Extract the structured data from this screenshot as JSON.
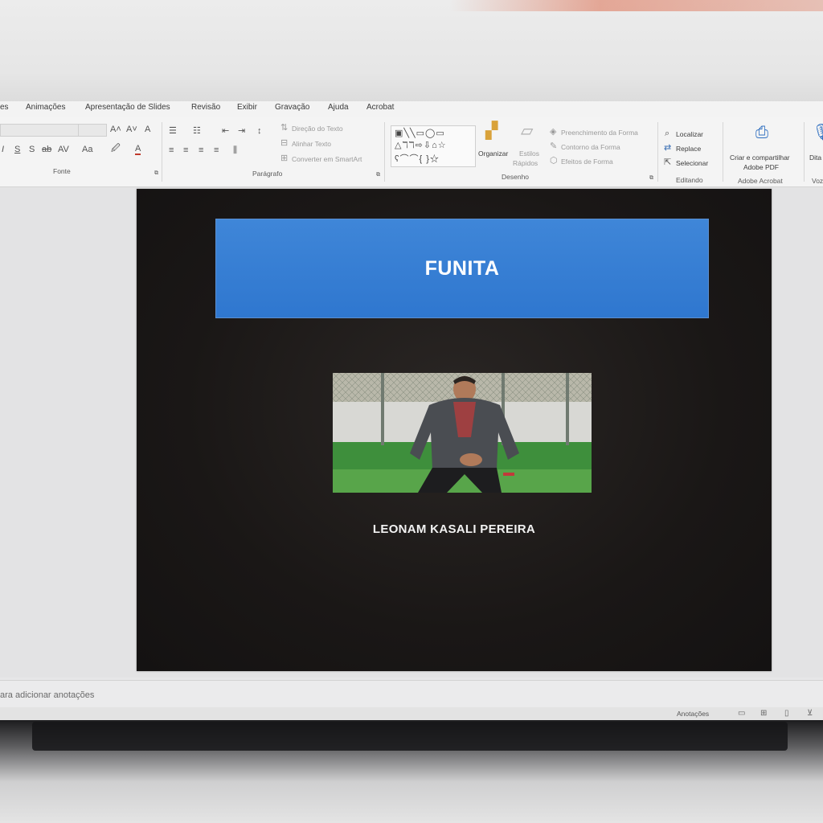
{
  "tabs": [
    "es",
    "Animações",
    "Apresentação de Slides",
    "Revisão",
    "Exibir",
    "Gravação",
    "Ajuda",
    "Acrobat"
  ],
  "ribbon": {
    "fonte": {
      "label": "Fonte",
      "grow": "A˄",
      "shrink": "A˅",
      "clear": "A",
      "italic": "I",
      "underline": "S",
      "shadow": "S",
      "strike": "ab",
      "spacing": "AV",
      "case": "Aa"
    },
    "paragrafo": {
      "label": "Parágrafo",
      "text_direction": "Direção do Texto",
      "align_text": "Alinhar Texto",
      "convert_smartart": "Converter em SmartArt"
    },
    "desenho": {
      "label": "Desenho",
      "organize": "Organizar",
      "quick_styles_1": "Estilos",
      "quick_styles_2": "Rápidos",
      "shape_fill": "Preenchimento da Forma",
      "shape_outline": "Contorno da Forma",
      "shape_effects": "Efeitos de Forma"
    },
    "editando": {
      "label": "Editando",
      "find": "Localizar",
      "replace": "Replace",
      "select": "Selecionar"
    },
    "acrobat": {
      "label": "Adobe Acrobat",
      "create_line1": "Criar e compartilhar",
      "create_line2": "Adobe PDF"
    },
    "voz": {
      "label": "Voz",
      "dictate": "Dita"
    }
  },
  "slide": {
    "title": "FUNITA",
    "caption": "LEONAM KASALI PEREIRA",
    "background_color": "#1a1716",
    "title_box_color": "#3a80d5"
  },
  "notes": {
    "placeholder": "ara adicionar anotações"
  },
  "status": {
    "notes_button": "Anotações"
  }
}
